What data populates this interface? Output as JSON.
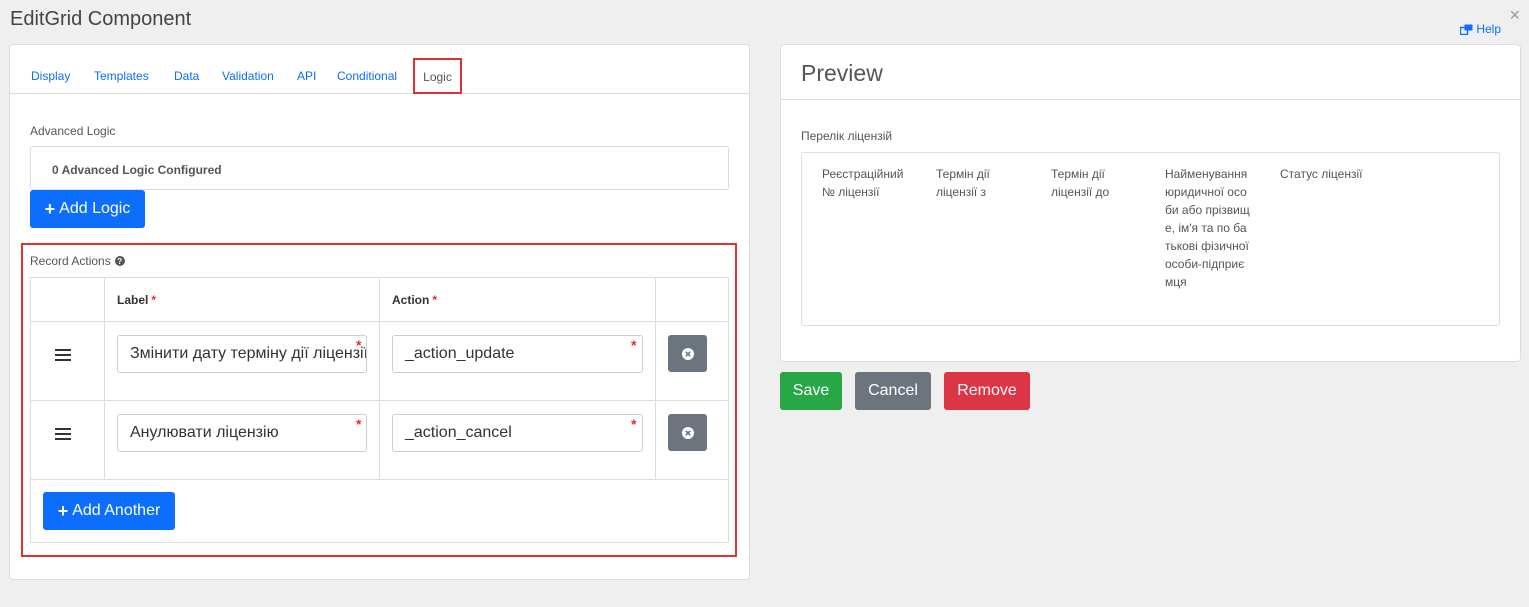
{
  "window": {
    "title": "EditGrid Component",
    "help_label": "Help",
    "close_glyph": "×"
  },
  "tabs": [
    {
      "label": "Display"
    },
    {
      "label": "Templates"
    },
    {
      "label": "Data"
    },
    {
      "label": "Validation"
    },
    {
      "label": "API"
    },
    {
      "label": "Conditional"
    },
    {
      "label": "Logic",
      "active": true
    }
  ],
  "advanced_logic": {
    "label": "Advanced Logic",
    "status": "0 Advanced Logic Configured",
    "add_button": "Add Logic"
  },
  "record_actions": {
    "label": "Record Actions",
    "columns": {
      "label": "Label",
      "action": "Action"
    },
    "required_mark": "*",
    "rows": [
      {
        "label": "Змінити дату терміну дії ліцензії",
        "action": "_action_update"
      },
      {
        "label": "Анулювати ліцензію",
        "action": "_action_cancel"
      }
    ],
    "add_button": "Add Another"
  },
  "preview": {
    "title": "Preview",
    "component_label": "Перелік ліцензій",
    "columns": [
      "Реєстраційний № ліцензії",
      "Термін дії ліцензії з",
      "Термін дії ліцензії до",
      "Найменування юридичної особи або прізвище, ім'я та по батькові фізичної особи-підприємця",
      "Статус ліцензії"
    ]
  },
  "footer_buttons": {
    "save": "Save",
    "cancel": "Cancel",
    "remove": "Remove"
  },
  "colors": {
    "primary": "#0d6efd",
    "success": "#28a745",
    "secondary": "#6c757d",
    "danger": "#dc3545",
    "highlight": "#e03131"
  },
  "icons": [
    "close-icon",
    "help-external-icon",
    "plus-icon",
    "question-circle-icon",
    "drag-handle-icon",
    "remove-row-icon"
  ]
}
